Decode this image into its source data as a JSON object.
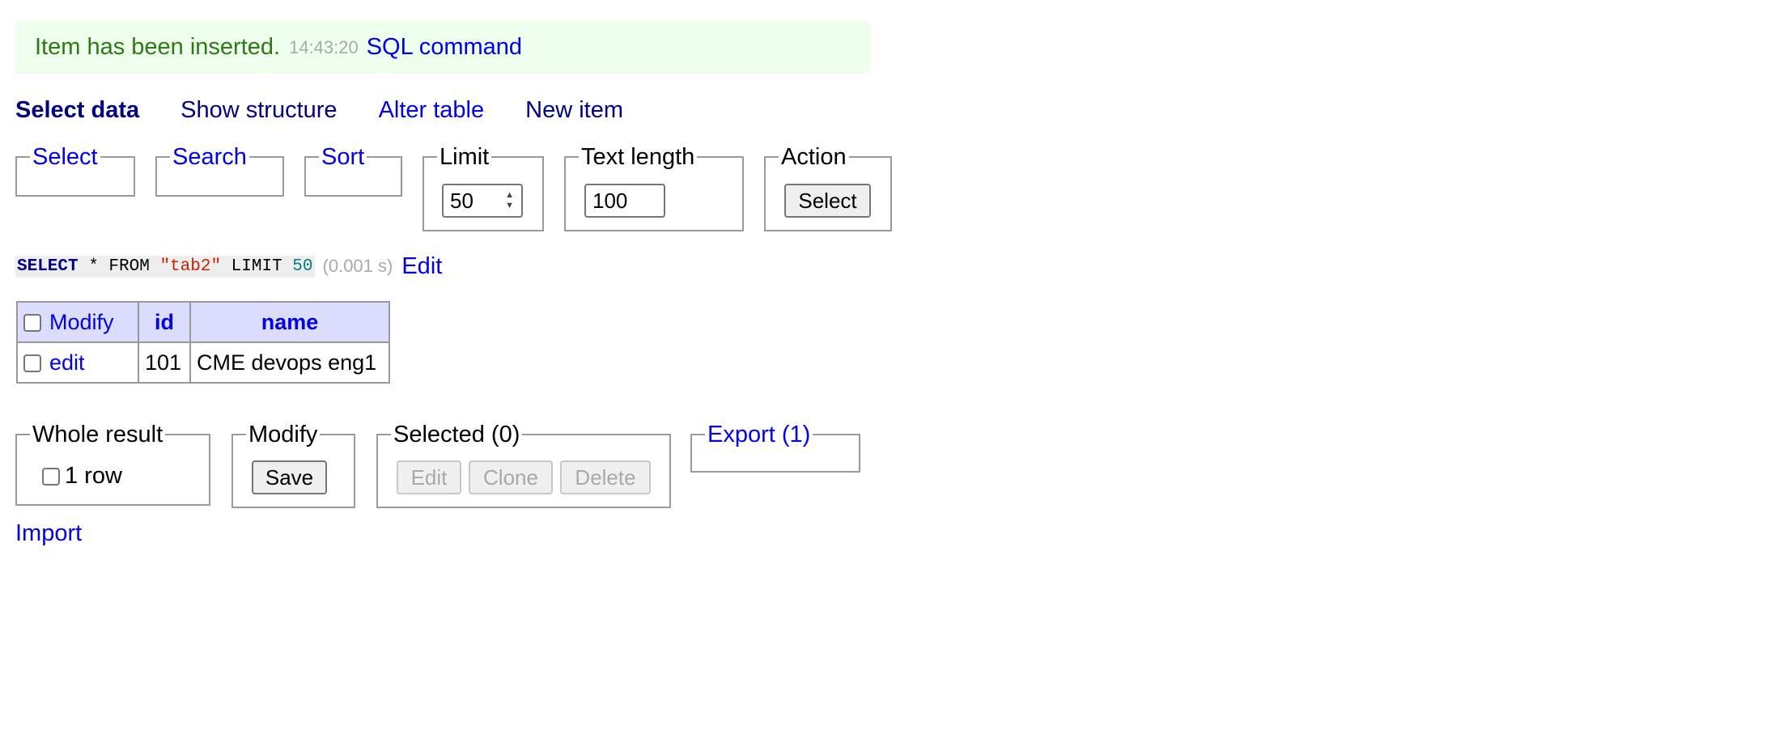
{
  "message": {
    "text": "Item has been inserted.",
    "time": "14:43:20",
    "sql_link": "SQL command"
  },
  "nav": {
    "current": "Select data",
    "show_structure": "Show structure",
    "alter_table": "Alter table",
    "new_item": "New item"
  },
  "controls": {
    "select_legend": "Select",
    "search_legend": "Search",
    "sort_legend": "Sort",
    "limit_legend": "Limit",
    "limit_value": "50",
    "text_length_legend": "Text length",
    "text_length_value": "100",
    "action_legend": "Action",
    "action_button": "Select"
  },
  "query": {
    "kw_select": "SELECT",
    "star_from": " * FROM ",
    "table": "\"tab2\"",
    "kw_limit": " LIMIT ",
    "limit": "50",
    "time": "(0.001 s)",
    "edit_link": "Edit"
  },
  "table": {
    "headers": {
      "modify": "Modify",
      "id": "id",
      "name": "name"
    },
    "rows": [
      {
        "edit": "edit",
        "id": "101",
        "name": "CME devops eng1"
      }
    ]
  },
  "bottom": {
    "whole_result_legend": "Whole result",
    "row_count": "1 row",
    "modify_legend": "Modify",
    "save_button": "Save",
    "selected_legend": "Selected (0)",
    "edit_button": "Edit",
    "clone_button": "Clone",
    "delete_button": "Delete",
    "export_legend": "Export (1)"
  },
  "import_link": "Import"
}
